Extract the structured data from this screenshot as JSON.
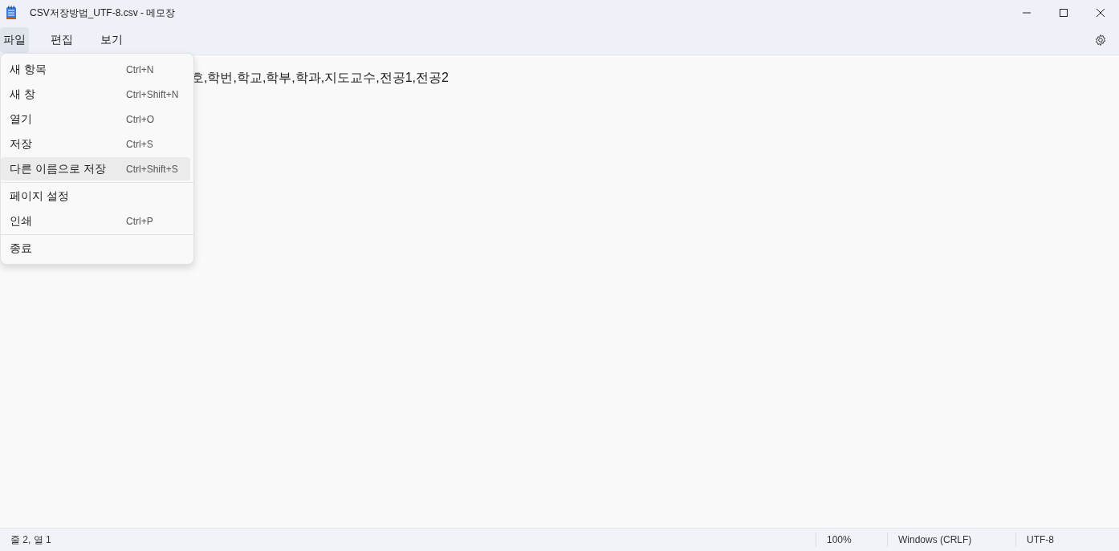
{
  "window": {
    "title": "CSV저장방법_UTF-8.csv - 메모장"
  },
  "menu_bar": [
    {
      "label": "파일",
      "selected": true
    },
    {
      "label": "편집",
      "selected": false
    },
    {
      "label": "보기",
      "selected": false
    }
  ],
  "file_menu": {
    "sections": [
      [
        {
          "label": "새 항목",
          "shortcut": "Ctrl+N",
          "selected": false
        },
        {
          "label": "새 창",
          "shortcut": "Ctrl+Shift+N",
          "selected": false
        },
        {
          "label": "열기",
          "shortcut": "Ctrl+O",
          "selected": false
        },
        {
          "label": "저장",
          "shortcut": "Ctrl+S",
          "selected": false
        },
        {
          "label": "다른 이름으로 저장",
          "shortcut": "Ctrl+Shift+S",
          "selected": true
        }
      ],
      [
        {
          "label": "페이지 설정",
          "selected": false
        },
        {
          "label": "인쇄",
          "shortcut": "Ctrl+P",
          "selected": false
        }
      ],
      [
        {
          "label": "종료",
          "selected": false
        }
      ]
    ]
  },
  "editor": {
    "text": "호,학번,학교,학부,학과,지도교수,전공1,전공2"
  },
  "status_bar": {
    "position": "줄 2, 열 1",
    "zoom": "100%",
    "line_ending": "Windows (CRLF)",
    "encoding": "UTF-8"
  }
}
